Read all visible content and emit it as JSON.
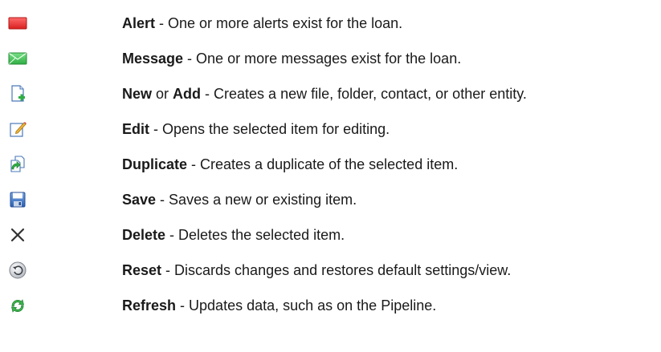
{
  "items": [
    {
      "icon": "alert-icon",
      "term": "Alert",
      "sep": " - ",
      "description": "One or more alerts exist for the loan."
    },
    {
      "icon": "message-icon",
      "term": "Message",
      "sep": " - ",
      "description": "One or more messages exist for the loan."
    },
    {
      "icon": "new-file-icon",
      "term": "New",
      "joiner": " or ",
      "term2": "Add",
      "sep": " - ",
      "description": "Creates a new file, folder, contact, or other entity."
    },
    {
      "icon": "edit-icon",
      "term": "Edit",
      "sep": " - ",
      "description": "Opens the selected item for editing."
    },
    {
      "icon": "duplicate-icon",
      "term": "Duplicate",
      "sep": " - ",
      "description": "Creates a duplicate of the selected item."
    },
    {
      "icon": "save-icon",
      "term": "Save",
      "sep": " - ",
      "description": "Saves a new or existing item."
    },
    {
      "icon": "delete-icon",
      "term": "Delete",
      "sep": " - ",
      "description": "Deletes the selected item."
    },
    {
      "icon": "reset-icon",
      "term": "Reset",
      "sep": " - ",
      "description": "Discards changes and restores default settings/view."
    },
    {
      "icon": "refresh-icon",
      "term": "Refresh",
      "sep": " - ",
      "description": "Updates data, such as on the Pipeline."
    }
  ]
}
